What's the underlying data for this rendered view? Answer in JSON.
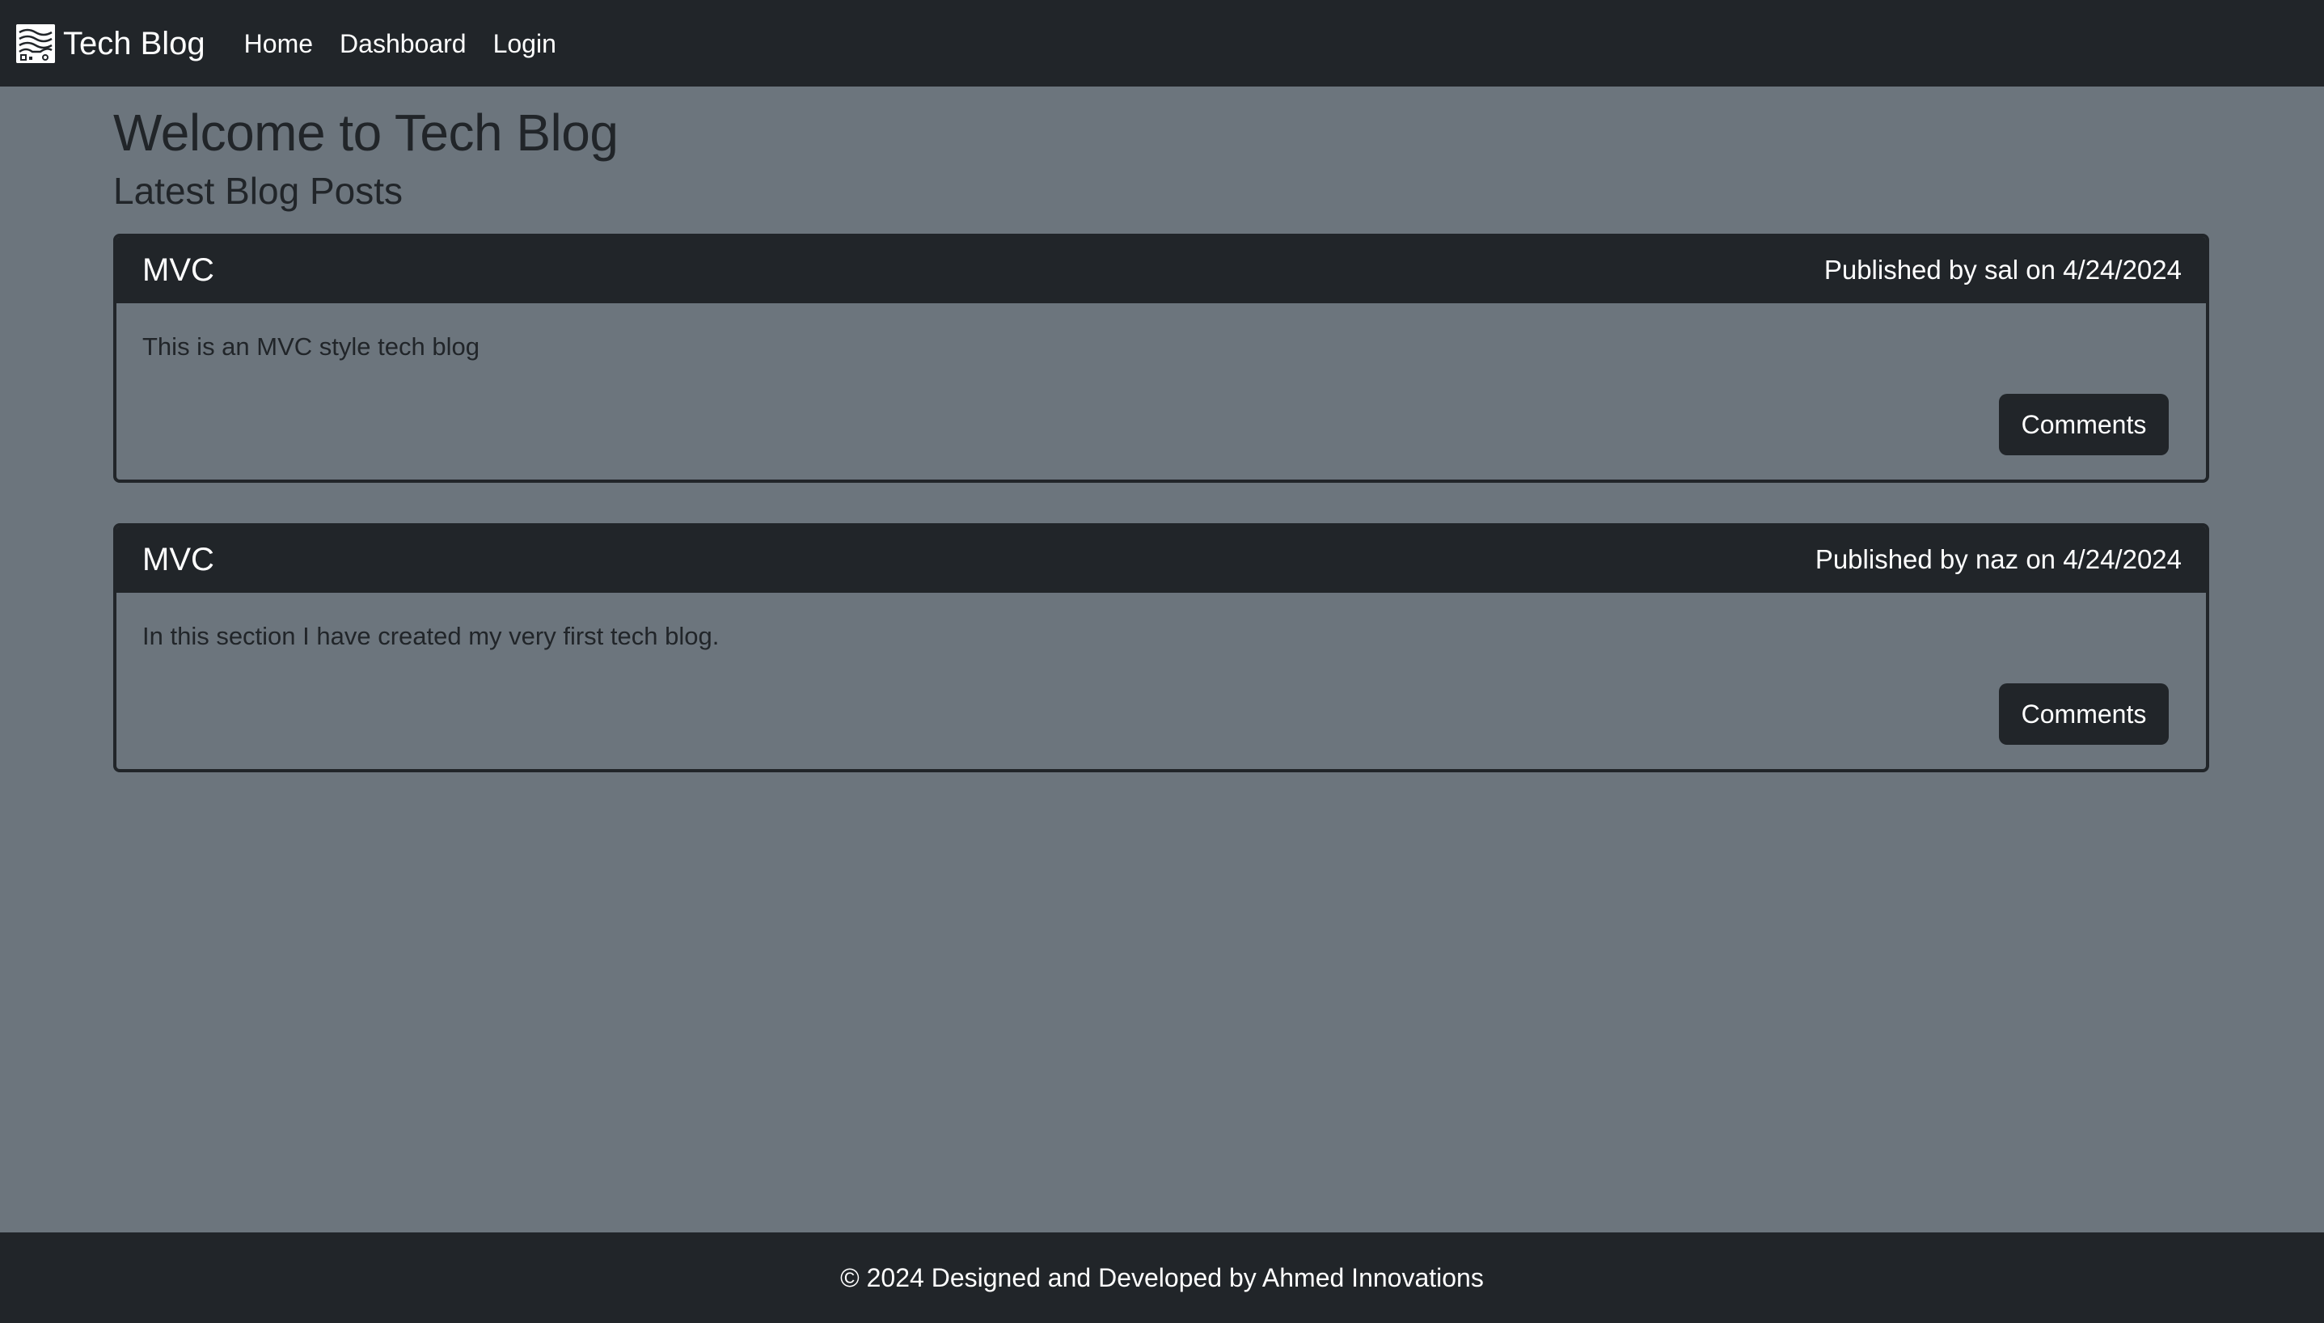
{
  "navbar": {
    "brand": "Tech Blog",
    "brand_logo_icon": "circuit-logo-icon",
    "links": [
      "Home",
      "Dashboard",
      "Login"
    ]
  },
  "main": {
    "title": "Welcome to Tech Blog",
    "subtitle": "Latest Blog Posts",
    "posts": [
      {
        "title": "MVC",
        "meta": "Published by sal on 4/24/2024",
        "body": "This is an MVC style tech blog",
        "button": "Comments"
      },
      {
        "title": "MVC",
        "meta": "Published by naz on 4/24/2024",
        "body": "In this section I have created my very first tech blog.",
        "button": "Comments"
      }
    ]
  },
  "footer": {
    "text": "© 2024 Designed and Developed by Ahmed Innovations"
  },
  "colors": {
    "background": "#6c757d",
    "dark": "#212529",
    "light_text": "#ffffff"
  }
}
